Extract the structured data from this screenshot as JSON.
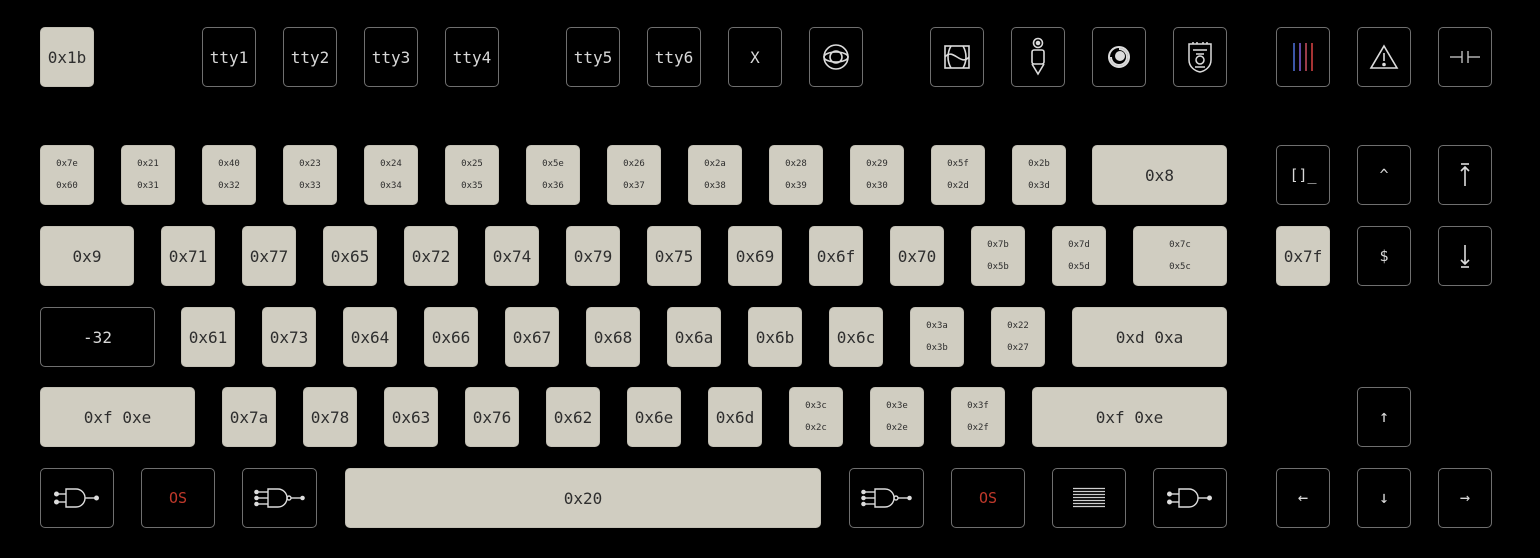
{
  "keys": {
    "esc": "0x1b",
    "tty1": "tty1",
    "tty2": "tty2",
    "tty3": "tty3",
    "tty4": "tty4",
    "tty5": "tty5",
    "tty6": "tty6",
    "x": "X",
    "row1": [
      {
        "top": "0x7e",
        "bottom": "0x60"
      },
      {
        "top": "0x21",
        "bottom": "0x31"
      },
      {
        "top": "0x40",
        "bottom": "0x32"
      },
      {
        "top": "0x23",
        "bottom": "0x33"
      },
      {
        "top": "0x24",
        "bottom": "0x34"
      },
      {
        "top": "0x25",
        "bottom": "0x35"
      },
      {
        "top": "0x5e",
        "bottom": "0x36"
      },
      {
        "top": "0x26",
        "bottom": "0x37"
      },
      {
        "top": "0x2a",
        "bottom": "0x38"
      },
      {
        "top": "0x28",
        "bottom": "0x39"
      },
      {
        "top": "0x29",
        "bottom": "0x30"
      },
      {
        "top": "0x5f",
        "bottom": "0x2d"
      },
      {
        "top": "0x2b",
        "bottom": "0x3d"
      }
    ],
    "backspace": "0x8",
    "tab": "0x9",
    "row2": [
      "0x71",
      "0x77",
      "0x65",
      "0x72",
      "0x74",
      "0x79",
      "0x75",
      "0x69",
      "0x6f",
      "0x70"
    ],
    "row2_dual": [
      {
        "top": "0x7b",
        "bottom": "0x5b"
      },
      {
        "top": "0x7d",
        "bottom": "0x5d"
      },
      {
        "top": "0x7c",
        "bottom": "0x5c"
      }
    ],
    "caps": "-32",
    "row3": [
      "0x61",
      "0x73",
      "0x64",
      "0x66",
      "0x67",
      "0x68",
      "0x6a",
      "0x6b",
      "0x6c"
    ],
    "row3_dual": [
      {
        "top": "0x3a",
        "bottom": "0x3b"
      },
      {
        "top": "0x22",
        "bottom": "0x27"
      }
    ],
    "enter": "0xd 0xa",
    "lshift": "0xf 0xe",
    "row4": [
      "0x7a",
      "0x78",
      "0x63",
      "0x76",
      "0x62",
      "0x6e",
      "0x6d"
    ],
    "row4_dual": [
      {
        "top": "0x3c",
        "bottom": "0x2c"
      },
      {
        "top": "0x3e",
        "bottom": "0x2e"
      },
      {
        "top": "0x3f",
        "bottom": "0x2f"
      }
    ],
    "rshift": "0xf 0xe",
    "os_left": "OS",
    "space": "0x20",
    "os_right": "OS",
    "ins": "[]_",
    "home": "^",
    "del": "0x7f",
    "end": "$",
    "arrow_up": "↑",
    "arrow_left": "←",
    "arrow_down": "↓",
    "arrow_right": "→"
  },
  "colors": {
    "background": "#000000",
    "key_light": "#d0cdc1",
    "key_dark": "#000000",
    "key_border_dark": "#6f6f6f",
    "os_red": "#c0392b"
  },
  "icons": {
    "f9": "circle-in-ellipse-icon",
    "f10": "double-arc-box-icon",
    "f11": "scroll-knob-icon",
    "f12": "spiral-icon",
    "f13": "shield-face-icon",
    "print": "colored-bars-icon",
    "warning": "warning-triangle-icon",
    "pause": "capacitor-icon",
    "pgup": "arrow-up-tick-icon",
    "pgdn": "arrow-down-tick-icon",
    "gate": "logic-gate-icon",
    "menu": "lines-menu-icon"
  }
}
